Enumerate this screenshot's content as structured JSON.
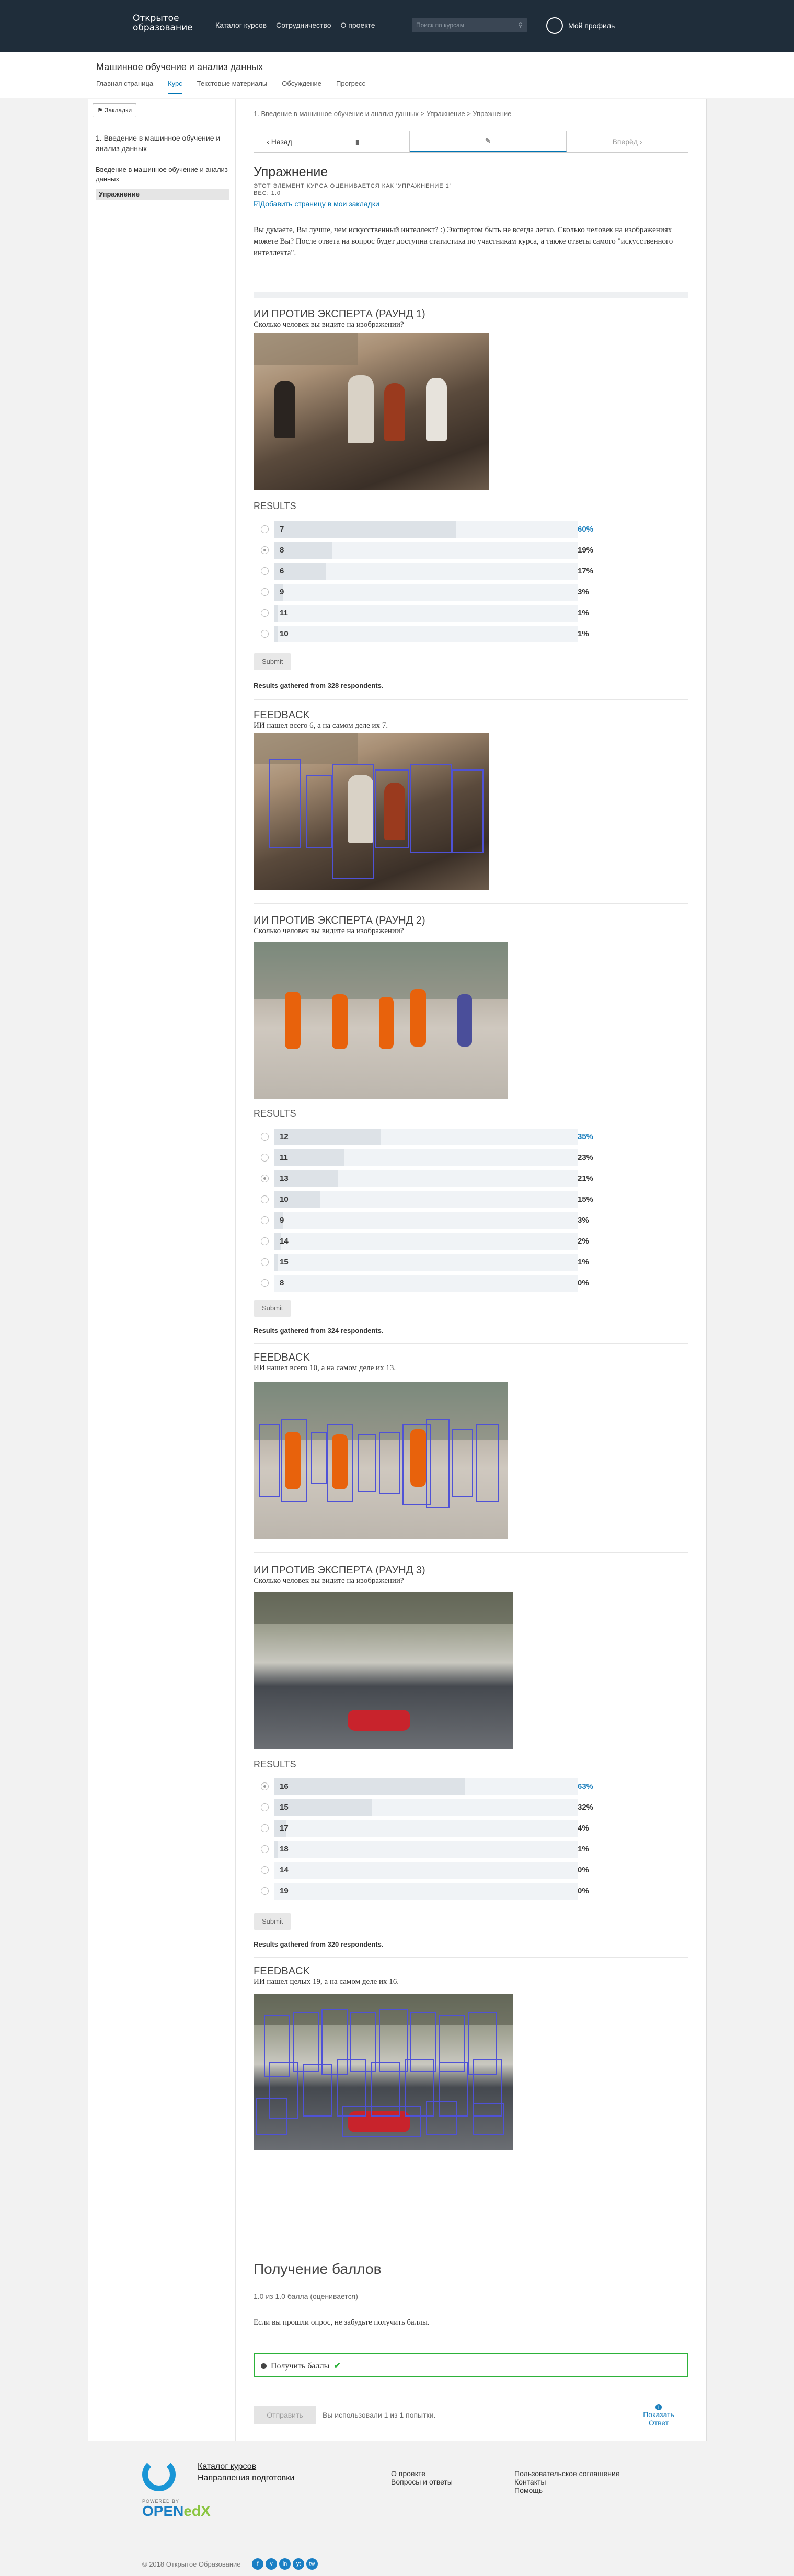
{
  "header": {
    "logo_line1": "Открытое",
    "logo_line2": "образование",
    "nav": [
      "Каталог курсов",
      "Сотрудничество",
      "О проекте"
    ],
    "search_placeholder": "Поиск по курсам",
    "profile": "Мой профиль"
  },
  "course": {
    "title": "Машинное обучение и анализ данных",
    "tabs": [
      "Главная страница",
      "Курс",
      "Текстовые материалы",
      "Обсуждение",
      "Прогресс"
    ]
  },
  "sidebar": {
    "bookmarks": "Закладки",
    "item1": "1. Введение в машинное обучение и анализ данных",
    "item2": "Введение в машинное обучение и анализ данных",
    "item3": "Упражнение"
  },
  "content": {
    "breadcrumb": "1. Введение в машинное обучение и анализ данных > Упражнение > Упражнение",
    "prev": "Назад",
    "next": "Вперёд",
    "title": "Упражнение",
    "graded_note": "ЭТОТ ЭЛЕМЕНТ КУРСА ОЦЕНИВАЕТСЯ КАК 'УПРАЖНЕНИЕ 1'",
    "weight": "ВЕС: 1.0",
    "bookmark_link": "Добавить страницу в мои закладки",
    "intro": "Вы думаете, Вы лучше, чем искусственный интеллект? :) Экспертом быть не всегда легко. Сколько человек на изображениях можете Вы? После ответа на вопрос будет доступна статистика по участникам курса, а также ответы самого \"искусственного интеллекта\"."
  },
  "rounds": [
    {
      "title": "ИИ ПРОТИВ ЭКСПЕРТА (РАУНД 1)",
      "question": "Сколько человек вы видите на изображении?",
      "results_label": "RESULTS",
      "options": [
        {
          "label": "7",
          "value": 60,
          "selected": false,
          "pct": "60%",
          "top": true
        },
        {
          "label": "8",
          "value": 19,
          "selected": true,
          "pct": "19%",
          "top": false
        },
        {
          "label": "6",
          "value": 17,
          "selected": false,
          "pct": "17%",
          "top": false
        },
        {
          "label": "9",
          "value": 3,
          "selected": false,
          "pct": "3%",
          "top": false
        },
        {
          "label": "11",
          "value": 1,
          "selected": false,
          "pct": "1%",
          "top": false
        },
        {
          "label": "10",
          "value": 1,
          "selected": false,
          "pct": "1%",
          "top": false
        }
      ],
      "submit": "Submit",
      "gathered": "Results gathered from 328 respondents.",
      "feedback_label": "FEEDBACK",
      "feedback_text": "ИИ нашел всего 6, а на самом деле их 7."
    },
    {
      "title": "ИИ ПРОТИВ ЭКСПЕРТА (РАУНД 2)",
      "question": "Сколько человек вы видите на изображении?",
      "results_label": "RESULTS",
      "options": [
        {
          "label": "12",
          "value": 35,
          "selected": false,
          "pct": "35%",
          "top": true
        },
        {
          "label": "11",
          "value": 23,
          "selected": false,
          "pct": "23%",
          "top": false
        },
        {
          "label": "13",
          "value": 21,
          "selected": true,
          "pct": "21%",
          "top": false
        },
        {
          "label": "10",
          "value": 15,
          "selected": false,
          "pct": "15%",
          "top": false
        },
        {
          "label": "9",
          "value": 3,
          "selected": false,
          "pct": "3%",
          "top": false
        },
        {
          "label": "14",
          "value": 2,
          "selected": false,
          "pct": "2%",
          "top": false
        },
        {
          "label": "15",
          "value": 1,
          "selected": false,
          "pct": "1%",
          "top": false
        },
        {
          "label": "8",
          "value": 0,
          "selected": false,
          "pct": "0%",
          "top": false
        }
      ],
      "submit": "Submit",
      "gathered": "Results gathered from 324 respondents.",
      "feedback_label": "FEEDBACK",
      "feedback_text": "ИИ нашел всего 10, а на самом деле их 13."
    },
    {
      "title": "ИИ ПРОТИВ ЭКСПЕРТА (РАУНД 3)",
      "question": "Сколько человек вы видите на изображении?",
      "results_label": "RESULTS",
      "options": [
        {
          "label": "16",
          "value": 63,
          "selected": true,
          "pct": "63%",
          "top": true
        },
        {
          "label": "15",
          "value": 32,
          "selected": false,
          "pct": "32%",
          "top": false
        },
        {
          "label": "17",
          "value": 4,
          "selected": false,
          "pct": "4%",
          "top": false
        },
        {
          "label": "18",
          "value": 1,
          "selected": false,
          "pct": "1%",
          "top": false
        },
        {
          "label": "14",
          "value": 0,
          "selected": false,
          "pct": "0%",
          "top": false
        },
        {
          "label": "19",
          "value": 0,
          "selected": false,
          "pct": "0%",
          "top": false
        }
      ],
      "submit": "Submit",
      "gathered": "Results gathered from 320 respondents.",
      "feedback_label": "FEEDBACK",
      "feedback_text": "ИИ нашел целых 19, а на самом деле их 16."
    }
  ],
  "grade": {
    "title": "Получение баллов",
    "subtitle": "1.0 из 1.0 балла (оценивается)",
    "text": "Если вы прошли опрос, не забудьте получить баллы.",
    "checkbox": "Получить баллы",
    "submit": "Отправить",
    "attempts": "Вы использовали 1 из 1 попытки.",
    "show_line1": "Показать",
    "show_line2": "Ответ"
  },
  "footer": {
    "link1": "Каталог курсов",
    "link2": "Направления подготовки",
    "about": "О проекте",
    "faq": "Вопросы и ответы",
    "agreement": "Пользовательское соглашение",
    "contacts": "Контакты",
    "help": "Помощь",
    "powered": "POWERED BY",
    "openedx_a": "OPEN",
    "openedx_b": "edX",
    "copyright": "© 2018 Открытое Образование",
    "social": [
      "f",
      "v",
      "in",
      "yt",
      "tw"
    ]
  },
  "colors": {
    "accent": "#0075b4",
    "header": "#1f2d3a",
    "check_border": "#2db23a"
  }
}
